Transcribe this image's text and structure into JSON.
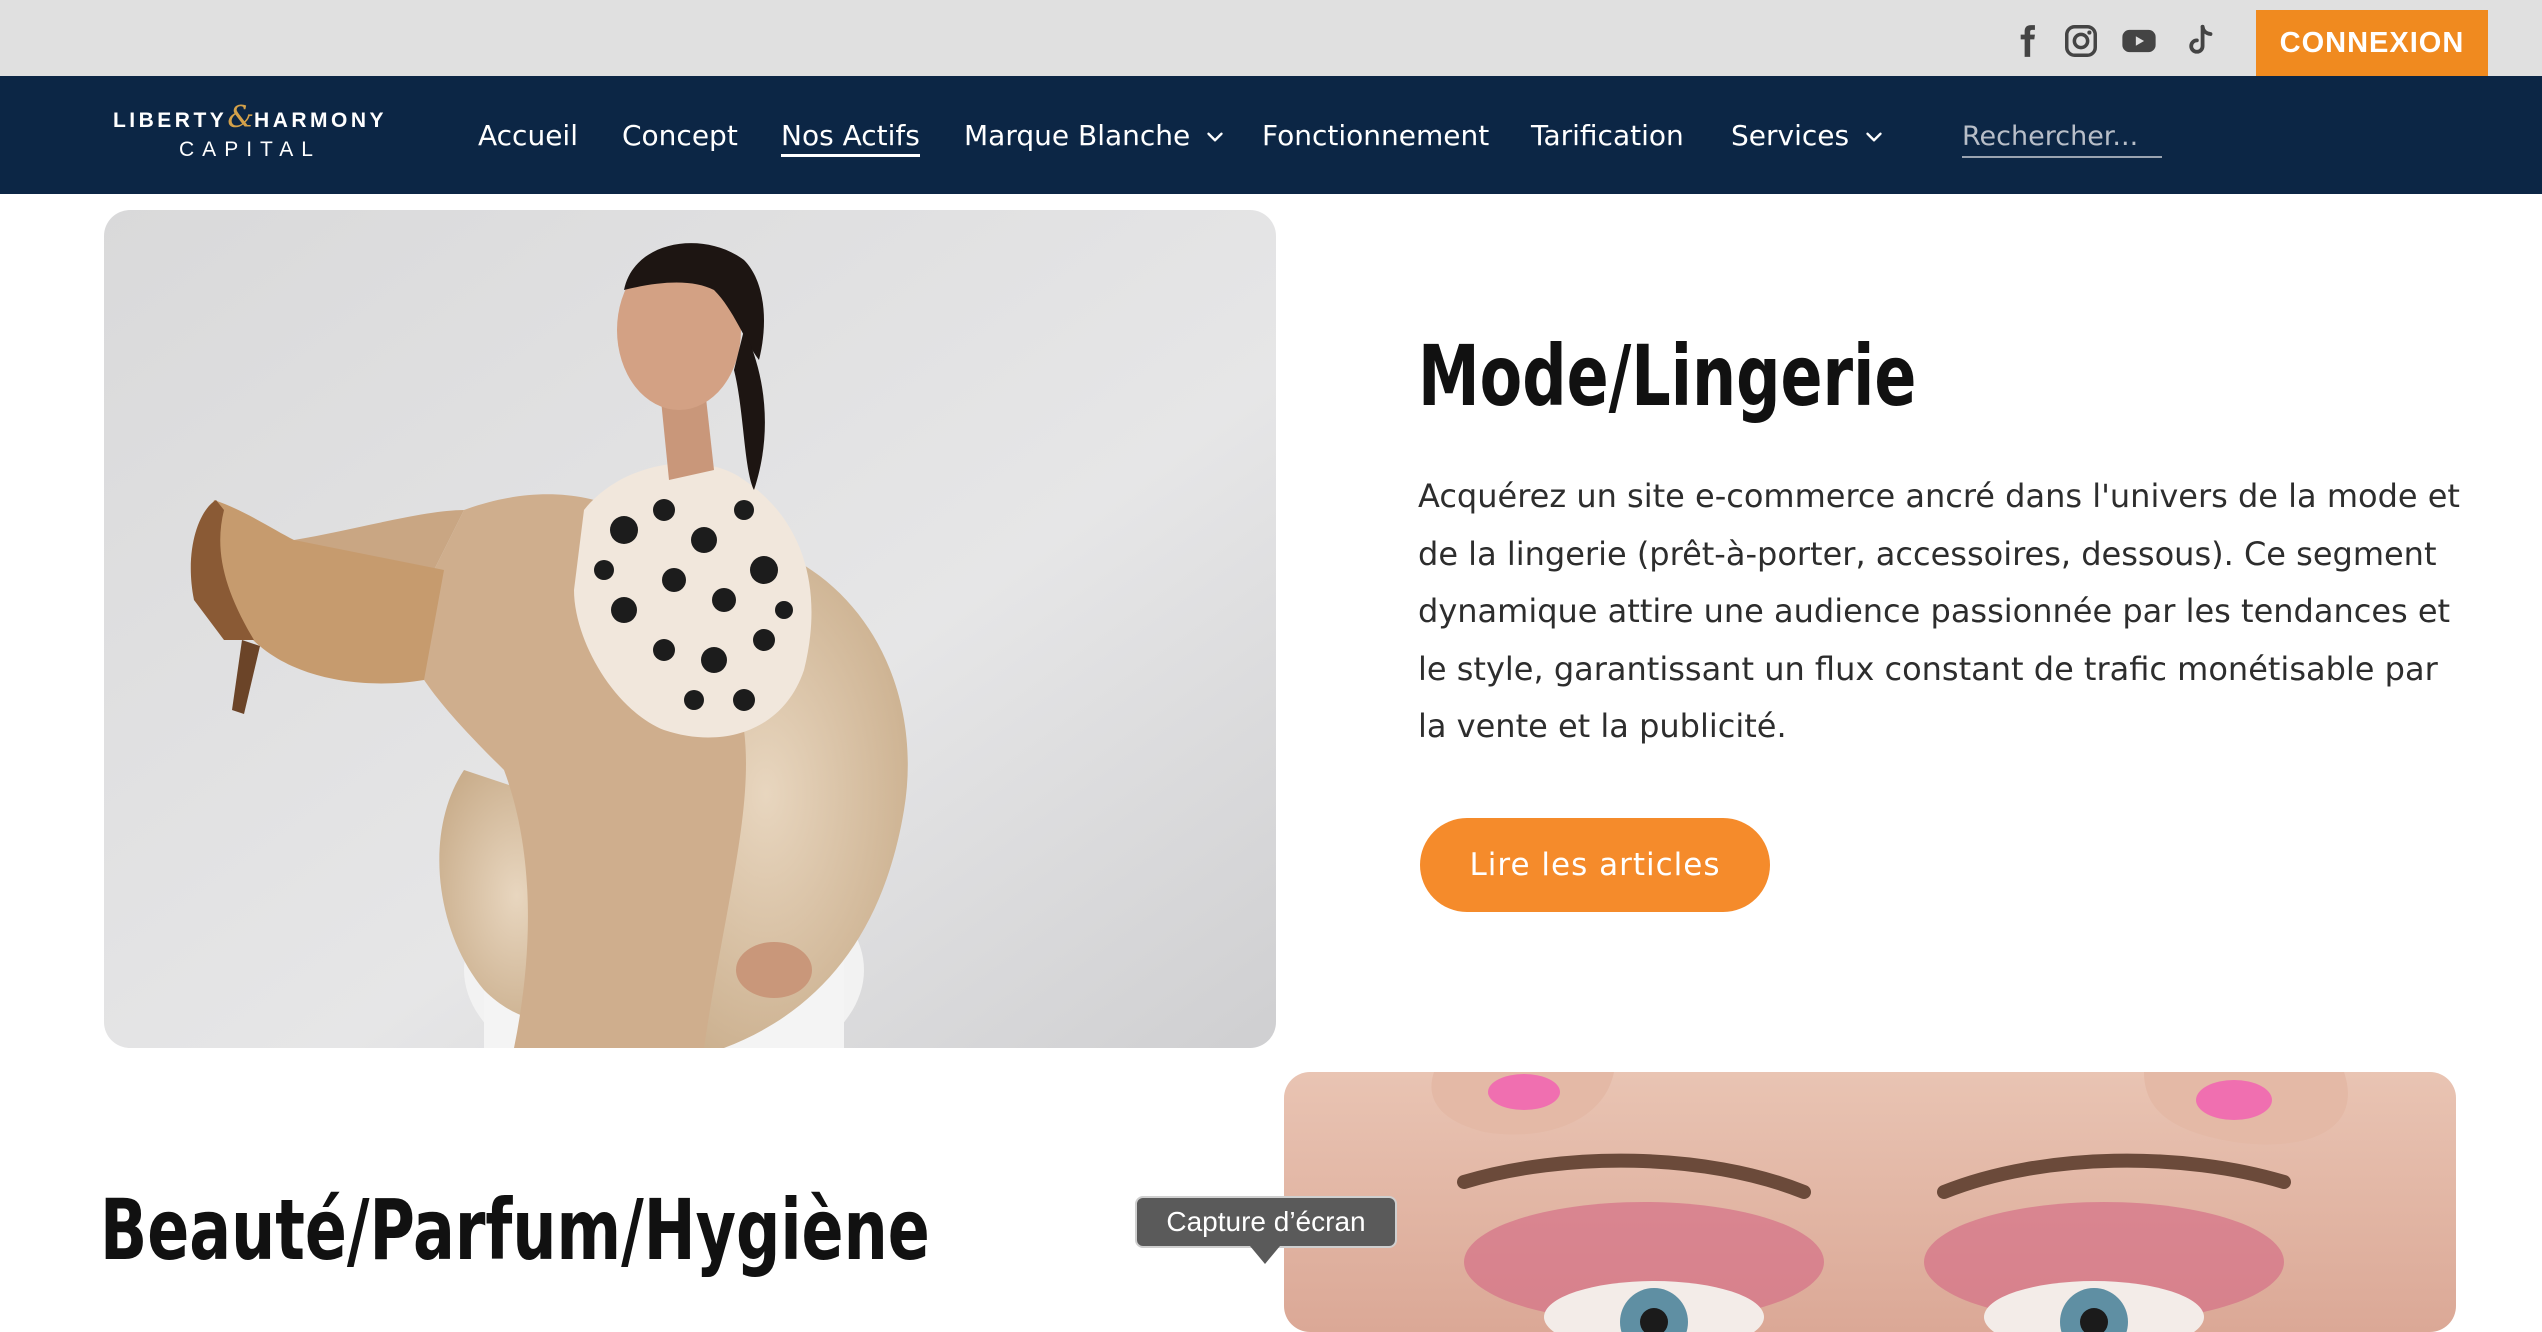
{
  "colors": {
    "topbar_bg": "#e0e0e0",
    "nav_bg": "#0c2645",
    "accent_orange": "#f08a1f",
    "logo_gold": "#d4a14a"
  },
  "topbar": {
    "social_icons": [
      "facebook-icon",
      "instagram-icon",
      "youtube-icon",
      "tiktok-icon"
    ],
    "login_label": "CONNEXION"
  },
  "logo": {
    "line1_left": "LIBERTY",
    "line1_amp": "&",
    "line1_right": "HARMONY",
    "line2": "CAPITAL"
  },
  "nav": {
    "items": [
      {
        "label": "Accueil"
      },
      {
        "label": "Concept"
      },
      {
        "label": "Nos Actifs"
      },
      {
        "label": "Marque Blanche"
      },
      {
        "label": "Fonctionnement"
      },
      {
        "label": "Tarification"
      },
      {
        "label": "Services"
      }
    ],
    "active": "Nos Actifs",
    "search_placeholder": "Rechercher..."
  },
  "sections": [
    {
      "title": "Mode/Lingerie",
      "description": "Acquérez un site e-commerce ancré dans l'univers de la mode et de la lingerie (prêt-à-porter, accessoires, dessous). Ce segment dynamique attire une audience passionnée par les tendances et le style, garantissant un flux constant de trafic monétisable par la vente et la publicité.",
      "cta_label": "Lire les articles"
    },
    {
      "title": "Beauté/Parfum/Hygiène"
    }
  ],
  "tooltip": {
    "label": "Capture d’écran"
  }
}
